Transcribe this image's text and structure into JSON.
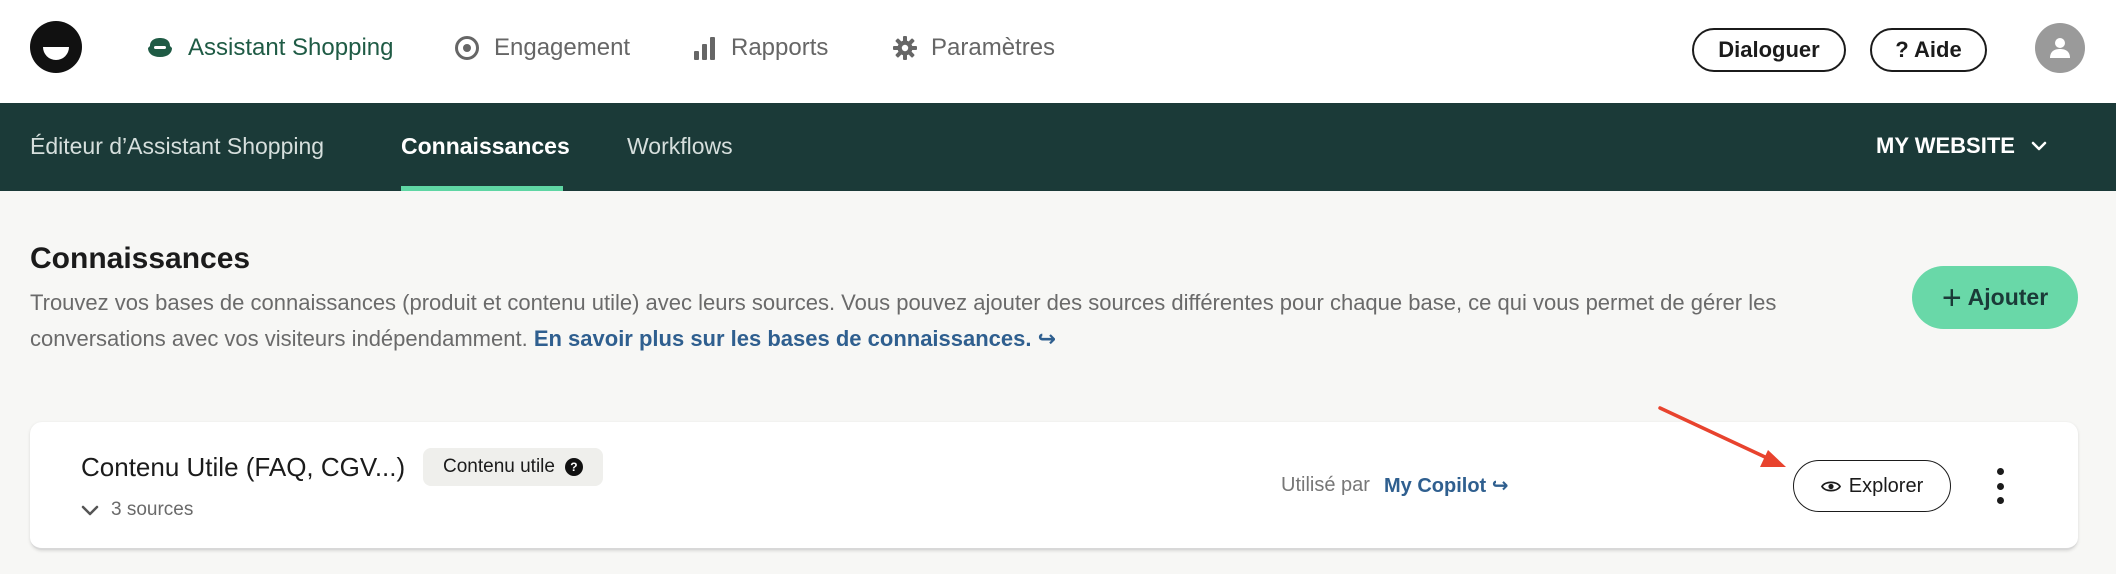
{
  "topnav": {
    "items": [
      {
        "label": "Assistant Shopping",
        "icon": "chat-bubble-icon",
        "active": true
      },
      {
        "label": "Engagement",
        "icon": "target-icon",
        "active": false
      },
      {
        "label": "Rapports",
        "icon": "bar-chart-icon",
        "active": false
      },
      {
        "label": "Paramètres",
        "icon": "gear-icon",
        "active": false
      }
    ],
    "dialog_button": "Dialoguer",
    "help_button": "? Aide"
  },
  "subnav": {
    "items": [
      {
        "label": "Éditeur d’Assistant Shopping",
        "active": false
      },
      {
        "label": "Connaissances",
        "active": true
      },
      {
        "label": "Workflows",
        "active": false
      }
    ],
    "website": "MY WEBSITE"
  },
  "page": {
    "title": "Connaissances",
    "description": "Trouvez vos bases de connaissances (produit et contenu utile) avec leurs sources. Vous pouvez ajouter des sources différentes pour chaque base, ce qui vous permet de gérer les conversations avec vos visiteurs indépendamment.",
    "learn_more": "En savoir plus sur les bases de connaissances. ↪",
    "add_button": "Ajouter"
  },
  "card": {
    "title": "Contenu Utile (FAQ, CGV...)",
    "badge": "Contenu utile",
    "sources": "3 sources",
    "used_by_label": "Utilisé par",
    "used_by_link": "My Copilot ↪",
    "explore_button": "Explorer"
  },
  "colors": {
    "brand_dark": "#1b3a38",
    "accent_green": "#69d8a8",
    "active_nav": "#1f5b45",
    "link_blue": "#2f5f8f",
    "annotation_arrow": "#e8432e"
  }
}
